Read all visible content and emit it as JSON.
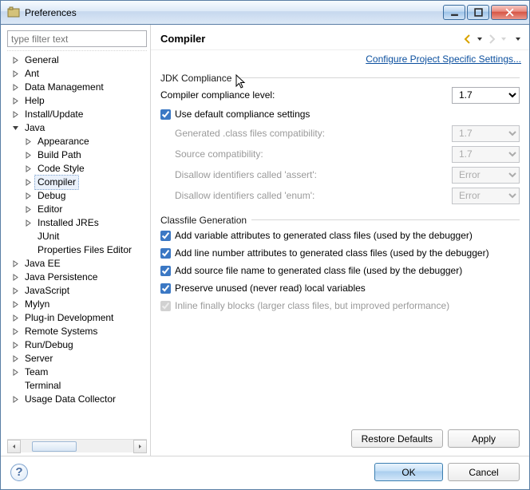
{
  "window": {
    "title": "Preferences"
  },
  "filter": {
    "placeholder": "type filter text"
  },
  "tree": {
    "general": "General",
    "ant": "Ant",
    "data_mgmt": "Data Management",
    "help": "Help",
    "install_update": "Install/Update",
    "java": "Java",
    "java_children": {
      "appearance": "Appearance",
      "build_path": "Build Path",
      "code_style": "Code Style",
      "compiler": "Compiler",
      "debug": "Debug",
      "editor": "Editor",
      "installed_jres": "Installed JREs",
      "junit": "JUnit",
      "prop_files": "Properties Files Editor"
    },
    "java_ee": "Java EE",
    "java_persistence": "Java Persistence",
    "javascript": "JavaScript",
    "mylyn": "Mylyn",
    "plugin_dev": "Plug-in Development",
    "remote_systems": "Remote Systems",
    "run_debug": "Run/Debug",
    "server": "Server",
    "team": "Team",
    "terminal": "Terminal",
    "usage_data": "Usage Data Collector"
  },
  "page": {
    "title": "Compiler",
    "config_link": "Configure Project Specific Settings...",
    "jdk_group": "JDK Compliance",
    "compliance_level_label": "Compiler compliance level:",
    "compliance_level_value": "1.7",
    "use_defaults": "Use default compliance settings",
    "gen_class_compat_label": "Generated .class files compatibility:",
    "gen_class_compat_value": "1.7",
    "source_compat_label": "Source compatibility:",
    "source_compat_value": "1.7",
    "disallow_assert_label": "Disallow identifiers called 'assert':",
    "disallow_assert_value": "Error",
    "disallow_enum_label": "Disallow identifiers called 'enum':",
    "disallow_enum_value": "Error",
    "classfile_group": "Classfile Generation",
    "cf_var_attrs": "Add variable attributes to generated class files (used by the debugger)",
    "cf_line_nums": "Add line number attributes to generated class files (used by the debugger)",
    "cf_source_name": "Add source file name to generated class file (used by the debugger)",
    "cf_preserve_unused": "Preserve unused (never read) local variables",
    "cf_inline_finally": "Inline finally blocks (larger class files, but improved performance)",
    "restore_defaults": "Restore Defaults",
    "apply": "Apply"
  },
  "footer": {
    "ok": "OK",
    "cancel": "Cancel"
  }
}
